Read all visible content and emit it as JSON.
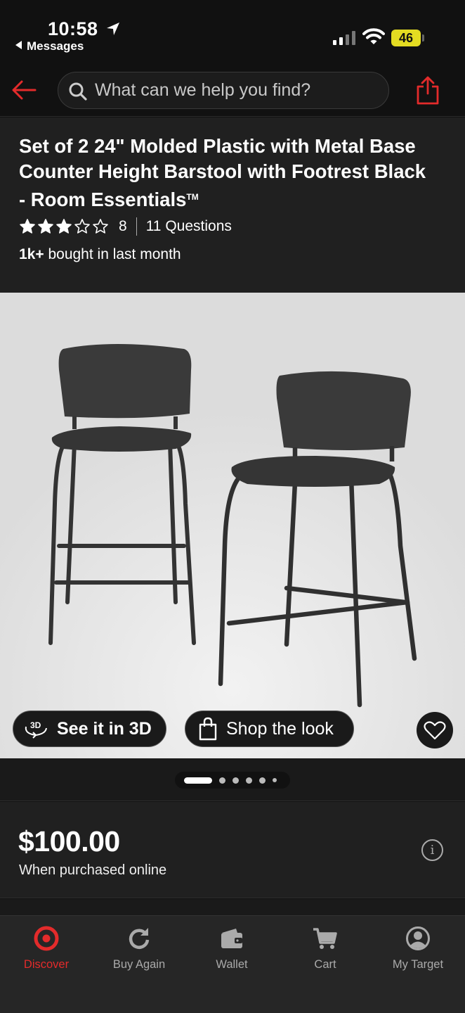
{
  "status_bar": {
    "time": "10:58",
    "back_app": "Messages",
    "battery": "46"
  },
  "search": {
    "placeholder": "What can we help you find?"
  },
  "product": {
    "title": "Set of 2 24\" Molded Plastic with Metal Base Counter Height Barstool with Footrest Black - Room Essentials",
    "trademark": "TM",
    "rating_stars": 3,
    "rating_max": 5,
    "review_count": "8",
    "questions": "11 Questions",
    "bought_bold": "1k+",
    "bought_rest": " bought in last month"
  },
  "gallery": {
    "see_3d_label": "See it in 3D",
    "shop_look_label": "Shop the look",
    "icon_3d_text": "3D",
    "dots_total": 6,
    "dots_active_index": 0
  },
  "price": {
    "amount": "$100.00",
    "note": "When purchased online",
    "info_glyph": "i"
  },
  "tabs": [
    {
      "label": "Discover",
      "icon": "bullseye-icon",
      "active": true
    },
    {
      "label": "Buy Again",
      "icon": "refresh-icon",
      "active": false
    },
    {
      "label": "Wallet",
      "icon": "wallet-icon",
      "active": false
    },
    {
      "label": "Cart",
      "icon": "cart-icon",
      "active": false
    },
    {
      "label": "My Target",
      "icon": "account-icon",
      "active": false
    }
  ],
  "colors": {
    "accent": "#e32b2b",
    "background": "#111111",
    "panel": "#202020",
    "battery": "#e4dc22"
  }
}
